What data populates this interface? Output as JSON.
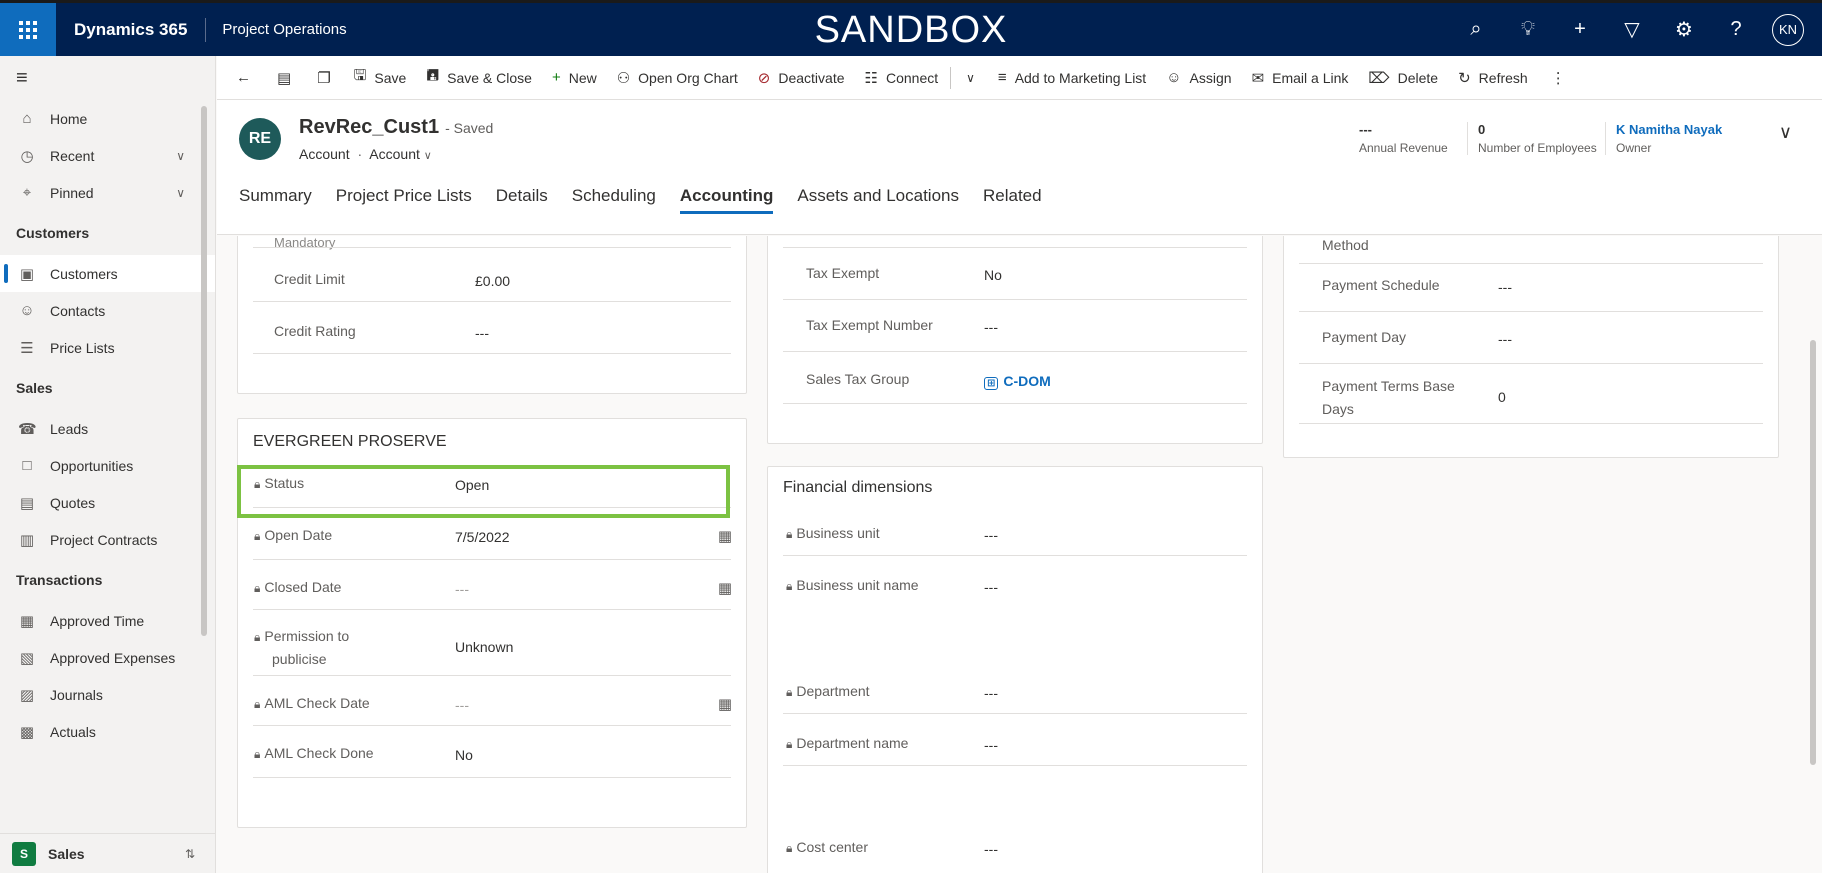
{
  "topbar": {
    "brand": "Dynamics 365",
    "app": "Project Operations",
    "banner": "SANDBOX",
    "icons": [
      "search-icon",
      "lightbulb-icon",
      "plus-icon",
      "filter-icon",
      "gear-icon",
      "help-icon"
    ],
    "user_initials": "KN"
  },
  "sidebar": {
    "top_items": [
      {
        "label": "Home",
        "icon": "home-icon"
      },
      {
        "label": "Recent",
        "icon": "clock-icon"
      },
      {
        "label": "Pinned",
        "icon": "pin-icon"
      }
    ],
    "sections": [
      {
        "title": "Customers",
        "items": [
          "Customers",
          "Contacts",
          "Price Lists"
        ]
      },
      {
        "title": "Sales",
        "items": [
          "Leads",
          "Opportunities",
          "Quotes",
          "Project Contracts"
        ]
      },
      {
        "title": "Transactions",
        "items": [
          "Approved Time",
          "Approved Expenses",
          "Journals",
          "Actuals"
        ]
      }
    ],
    "active_item": "Customers",
    "area": {
      "badge": "S",
      "label": "Sales"
    }
  },
  "commandbar": {
    "save": "Save",
    "save_close": "Save & Close",
    "new": "New",
    "org_chart": "Open Org Chart",
    "deactivate": "Deactivate",
    "connect": "Connect",
    "add_marketing": "Add to Marketing List",
    "assign": "Assign",
    "email_link": "Email a Link",
    "delete": "Delete",
    "refresh": "Refresh"
  },
  "header": {
    "avatar": "RE",
    "title": "RevRec_Cust1",
    "saved": "- Saved",
    "entity": "Account",
    "form": "Account",
    "annual_revenue": {
      "value": "---",
      "label": "Annual Revenue"
    },
    "employees": {
      "value": "0",
      "label": "Number of Employees"
    },
    "owner": {
      "value": "K Namitha Nayak",
      "label": "Owner"
    },
    "tabs": [
      "Summary",
      "Project Price Lists",
      "Details",
      "Scheduling",
      "Accounting",
      "Assets and Locations",
      "Related"
    ],
    "active_tab": "Accounting"
  },
  "col1": {
    "partial_label": "Mandatory",
    "credit_limit": {
      "label": "Credit Limit",
      "value": "£0.00"
    },
    "credit_rating": {
      "label": "Credit Rating",
      "value": "---"
    },
    "section_title": "EVERGREEN PROSERVE",
    "status": {
      "label": "Status",
      "value": "Open"
    },
    "open_date": {
      "label": "Open Date",
      "value": "7/5/2022"
    },
    "closed_date": {
      "label": "Closed Date",
      "value": "---"
    },
    "permission": {
      "label1": "Permission to",
      "label2": "publicise",
      "value": "Unknown"
    },
    "aml_date": {
      "label": "AML Check Date",
      "value": "---"
    },
    "aml_done": {
      "label": "AML Check Done",
      "value": "No"
    }
  },
  "col2": {
    "tax_exempt": {
      "label": "Tax Exempt",
      "value": "No"
    },
    "tax_exempt_number": {
      "label": "Tax Exempt Number",
      "value": "---"
    },
    "sales_tax_group": {
      "label": "Sales Tax Group",
      "value": "C-DOM"
    },
    "fin_title": "Financial dimensions",
    "business_unit": {
      "label": "Business unit",
      "value": "---"
    },
    "business_unit_name": {
      "label": "Business unit name",
      "value": "---"
    },
    "department": {
      "label": "Department",
      "value": "---"
    },
    "department_name": {
      "label": "Department name",
      "value": "---"
    },
    "cost_center": {
      "label": "Cost center",
      "value": "---"
    }
  },
  "col3": {
    "method": "Method",
    "payment_schedule": {
      "label": "Payment Schedule",
      "value": "---"
    },
    "payment_day": {
      "label": "Payment Day",
      "value": "---"
    },
    "terms_base": {
      "label1": "Payment Terms Base",
      "label2": "Days",
      "value": "0"
    }
  }
}
